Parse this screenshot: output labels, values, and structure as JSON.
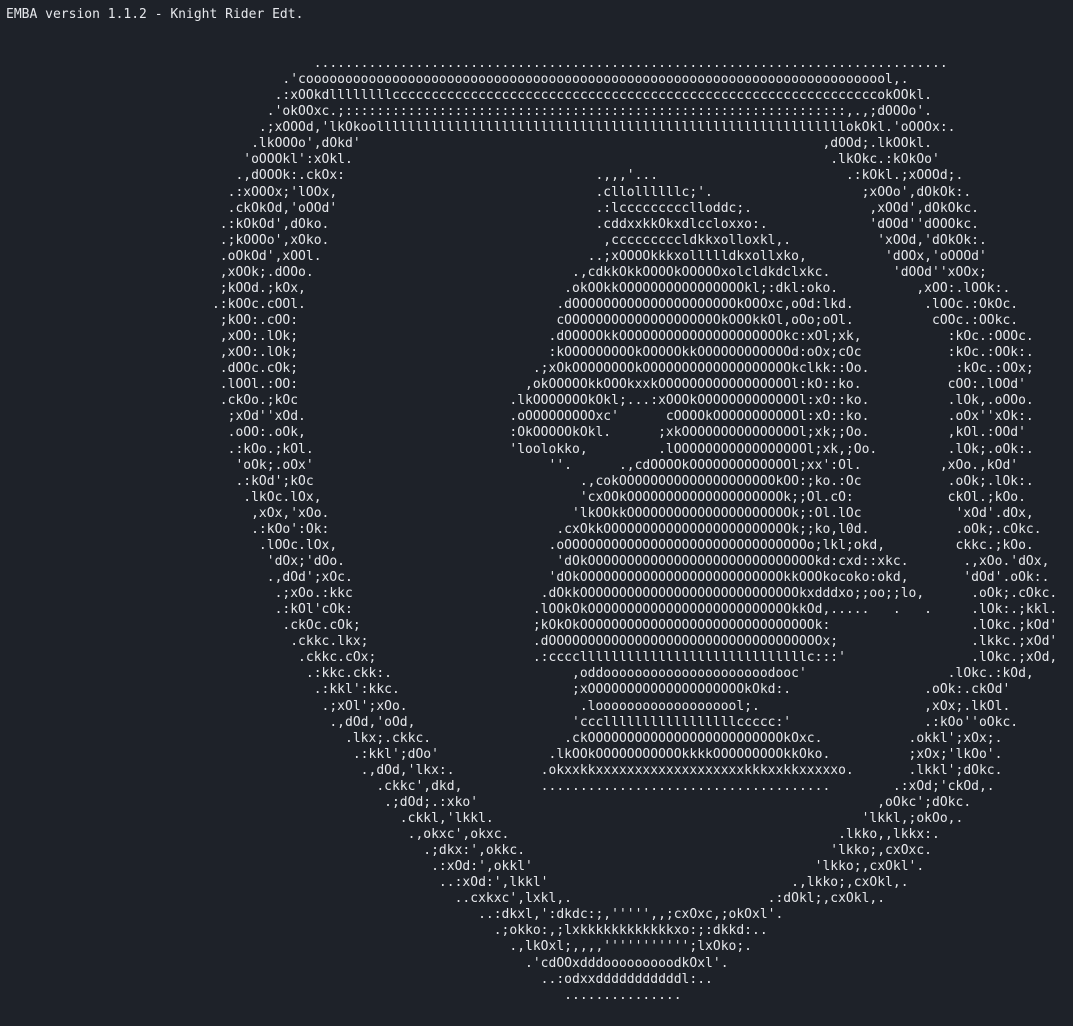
{
  "terminal": {
    "header": "EMBA version 1.1.2 - Knight Rider Edt.",
    "art_lines": [
      "                   .................................................................................",
      "               .'cooooooooooooooooooooooooooooooooooooooooooooooooooooooooooooooooooooooooool,.",
      "              .:xOOkdllllllllccccccccccccccccccccccccccccccccccccccccccccccccccccccccccccccokOOkl.",
      "             .'okOOxc.;::::::::::::::::::::::::::::::::::::::::::::::::::::::::::::::::,.,;dOOOo'.",
      "            .;xOOOd,'lkOkoollllllllllllllllllllllllllllllllllllllllllllllllllllllllllllokOkl.'oOOOx:.",
      "           .lkOOOo',dOkd'                                                           ,dOOd;.lkOOkl.",
      "          'oOOOkl':xOkl.                                                             .lkOkc.:kOkOo'",
      "         .,dOOOk:.ckOx:                                .,,,'...                        .:kOkl.;xOOOd;.",
      "        .:xOOOx;'lOOx,                                 .cllollllllc;'.                   ;xOOo',dOkOk:.",
      "        .ckOkOd,'oOOd'                                 .:lccccccccclloddc;.               ,xOOd',dOkOkc.",
      "       .:kOkOd',dOko.                                  .cddxxkkOkxdlccloxxo:.             'dOOd''dOOOkc.",
      "       .;kOOOo',xOko.                                   ,cccccccccldkkxolloxkl,.           'xOOd,'dOkOk:.",
      "       .oOkOd',xOOl.                                  ..;xOOOOkkkxollllldkxollxko,          'dOOx,'oOOOd'",
      "       ,xOOk;.dOOo.                                 .,cdkkOkkOOOOkOOOOOxolcldkdclxkc.        'dOOd''xOOx;",
      "       ;kOOd.;kOx,                                 .okOOkkOOOOOOOOOOOOOOOOkl;:dkl:oko.          ,xOO:.lOOk:.",
      "      .:kOOc.cOOl.                                .dOOOOOOOOOOOOOOOOOOOOOkOOOxc,oOd:lkd.         .lOOc.:OkOc.",
      "       ;kOO:.cOO:                                 cOOOOOOOOOOOOOOOOOOOOkOOOkkOl,oOo;oOl.          cOOc.:OOkc.",
      "       ,xOO:.lOk;                                .dOOOOOkkOOOOOOOOOOOOOOOOOOOOOkc:xOl;xk,           :kOc.:OOOc.",
      "       ,xOO:.lOk;                                :kOOOOOOOOOkOOOOOkkOOOOOOOOOOOOd:oOx;cOc           :kOc.:OOk:.",
      "       .dOOc.cOk;                              .;xOkOOOOOOOOkOOOOOOOOOOOOOOOOOOOkclkk::Oo.           :kOc.:OOx;",
      "       .lOOl.:OO:                             ,okOOOOOkkOOOkxxkOOOOOOOOOOOOOOOOOl:kO::ko.           cOO:.lOOd'",
      "       .ckOo.;kOc                           .lkOOOOOOOkOkl;...:xOOOkOOOOOOOOOOOOOl:xO::ko.          .lOk,.oOOo.",
      "        ;xOd''xOd.                          .oOOOOOOOOOxc'      cOOOOkOOOOOOOOOOOl:xO::ko.          .oOx''xOk:.",
      "        .oOO:.oOk,                          :OkOOOOOkOkl.      ;xkOOOOOOOOOOOOOOOl;xk;;Oo.          ,kOl.:OOd'",
      "        .:kOo.;kOl.                         'loolokko,         .lOOOOOOOOOOOOOOOOOl;xk,;Oo.         .lOk;.oOk:.",
      "         'oOk;.oOx'                              ''.      .,cdOOOOkOOOOOOOOOOOOOl;xx':Ol.          ,xOo.,kOd'",
      "         .:kOd';kOc                                  .,cokOOOOOOOOOOOOOOOOOOOOkOO:;ko.:Oc           .oOk;.lOk:.",
      "          .lkOc.lOx,                                 'cxOOkOOOOOOOOOOOOOOOOOOOOk;;Ol.cO:            ckOl.;kOo.",
      "           ,xOx,'xOo.                               'lkOOkkOOOOOOOOOOOOOOOOOOOOOk;:Ol.lOc            'xOd'.dOx,",
      "           .:kOo':Ok:                             .cxOkkOOOOOOOOOOOOOOOOOOOOOOOOk;;ko,l0d.           .oOk;.cOkc.",
      "            .lOOc.lOx,                           .oOOOOOOOOOOOOOOOOOOOOOOOOOOOOOOOo;lkl;okd,         ckkc.;kOo.",
      "             'dOx;'dOo.                           'dOkOOOOOOOOOOOOOOOOOOOOOOOOOOOOOkd:cxd::xkc.       .,xOo.'dOx,",
      "             .,dOd';xOc.                         'dOkOOOOOOOOOOOOOOOOOOOOOOOOOOkkOOOkocoko:okd,       'dOd'.oOk:.",
      "              .;xOo.:kkc                        .dOkkOOOOOOOOOOOOOOOOOOOOOOOOOOOOkxdddxo;;oo;;lo,      .oOk;.cOkc.",
      "              .:kOl'cOk:                       .lOOkOkOOOOOOOOOOOOOOOOOOOOOOOOOOkkOd,.....   .   .     .lOk:.;kkl.",
      "               .ckOc.cOk;                      ;kOkOkOOOOOOOOOOOOOOOOOOOOOOOOOOOOOOk:                  .lOkc.;kOd'",
      "                .ckkc.lkx;                     .dOOOOOOOOOOOOOOOOOOOOOOOOOOOOOOOOOOOx;                 .lkkc.;xOd'",
      "                 .ckkc.cOx;                    .:cccclllllllllllllllllllllllllllllc:::'                .lOkc.;xOd,",
      "                  .:kkc.ckk:.                       ,oddooooooooooooooooooooodooc'                  .lOkc.:kOd,",
      "                   .:kkl':kkc.                      ;xOOOOOOOOOOOOOOOOOOOOkOkd:.                 .oOk:.ckOd'",
      "                    .;xOl';xOo.                      .looooooooooooooooool;.                     ,xOx;.lkOl.",
      "                     .,dOd,'oOd,                    'ccclllllllllllllllllccccc:'                 .:kOo''oOkc.",
      "                       .lkx;.ckkc.                 .ckOOOOOOOOOOOOOOOOOOOOOOOOOkOxc.           .okkl';xOx;.",
      "                        .:kkl';dOo'              .lkOOkOOOOOOOOOOOkkkkOOOOOOOOOkkOko.          ;xOx;'lkOo'.",
      "                         .,dOd,'lkx:.           .okxxkkxxxxxxxxxxxxxxxxxxxkkkxxkkxxxxxo.       .lkkl';dOkc.",
      "                           .ckkc',dkd,          .....................................        .:xOd;'ckOd,.",
      "                            .;dOd;.:xko'                                                   ,oOkc';dOkc.",
      "                              .ckkl,'lkkl.                                               'lkkl,;okOo,.",
      "                               .,okxc',okxc.                                          .lkko,,lkkx:.",
      "                                 .;dkx:',okkc.                                       'lkko;,cxOxc.",
      "                                  .:xOd:',okkl'                                    'lkko;,cxOkl'.",
      "                                   ..:xOd:',lkkl'                               .,lkko;,cxOkl,.",
      "                                     ..cxkxc',lxkl,.                         .:dOkl;,cxOkl,.",
      "                                        ..:dkxl,':dkdc:;,''''',,;cxOxc,;okOxl'.",
      "                                          .;okko:,;lxkkkkkkkkkkkkxo:;:dkkd:..",
      "                                            .,lkOxl;,,,,''''''''''';lxOko;.",
      "                                              .'cdOOxdddooooooooodkOxl'.",
      "                                                ..:odxxdddddddddddl:..",
      "                                                   ..............."
    ]
  }
}
